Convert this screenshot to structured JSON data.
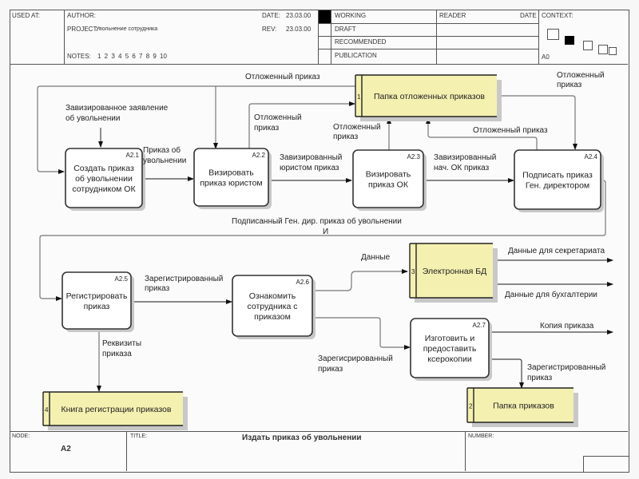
{
  "header": {
    "used_at_label": "USED AT:",
    "author_label": "AUTHOR:",
    "project_label": "PROJECT:",
    "project_value": "Увольнение сотрудника",
    "notes_label": "NOTES:",
    "notes_values": "1  2  3  4  5  6  7  8  9  10",
    "date_label": "DATE:",
    "date_value": "23.03.00",
    "rev_label": "REV:",
    "rev_value": "23.03.00",
    "status_options": [
      "WORKING",
      "DRAFT",
      "RECOMMENDED",
      "PUBLICATION"
    ],
    "status_selected": "WORKING",
    "reader_label": "READER",
    "reader_date_label": "DATE",
    "context_label": "CONTEXT:",
    "context_node": "A0"
  },
  "diagram": {
    "activities": [
      {
        "id": "A2.1",
        "lines": [
          "Создать приказ",
          "об увольнении",
          "сотрудником ОК"
        ]
      },
      {
        "id": "A2.2",
        "lines": [
          "Визировать",
          "приказ юристом"
        ]
      },
      {
        "id": "A2.3",
        "lines": [
          "Визировать",
          "приказ ОК"
        ]
      },
      {
        "id": "A2.4",
        "lines": [
          "Подписать приказ",
          "Ген. директором"
        ]
      },
      {
        "id": "A2.5",
        "lines": [
          "Регистрировать",
          "приказ"
        ]
      },
      {
        "id": "A2.6",
        "lines": [
          "Ознакомить",
          "сотрудника с",
          "приказом"
        ]
      },
      {
        "id": "A2.7",
        "lines": [
          "Изготовить и",
          "предоставить",
          "ксерокопии"
        ]
      }
    ],
    "data_stores": [
      {
        "num": "1",
        "label": "Папка отложенных приказов"
      },
      {
        "num": "2",
        "label": "Папка приказов"
      },
      {
        "num": "3",
        "label": "Электронная БД"
      },
      {
        "num": "4",
        "label": "Книга регистрации приказов"
      }
    ],
    "arrow_labels": {
      "postponed_top": "Отложенный приказ",
      "postponed_right": [
        "Отложенный",
        "приказ"
      ],
      "approved_application": [
        "Завизированное заявление",
        "об увольнении"
      ],
      "postponed_a22": [
        "Отложенный",
        "приказ"
      ],
      "postponed_a23": [
        "Отложенный",
        "приказ"
      ],
      "postponed_a24": "Отложенный приказ",
      "order_dismissal": [
        "Приказ об",
        "увольнении"
      ],
      "approved_by_lawyer": [
        "Завизированный",
        "юристом приказ"
      ],
      "approved_by_hr": [
        "Завизированный",
        "нач. ОК приказ"
      ],
      "signed_order": [
        "Подписанный Ген. дир. приказ об увольнении",
        "И"
      ],
      "registered_order_a25": [
        "Зарегистрированный",
        "приказ"
      ],
      "data": "Данные",
      "data_secretariat": "Данные для секретариата",
      "data_accounting": "Данные для бухгалтерии",
      "order_details": [
        "Реквизиты",
        "приказа"
      ],
      "registered_order_a26": [
        "Зарегисрированный",
        "приказ"
      ],
      "order_copy": "Копия приказа",
      "registered_order_a27": [
        "Зарегистрированный",
        "приказ"
      ]
    }
  },
  "footer": {
    "node_label": "NODE:",
    "node_value": "A2",
    "title_label": "TITLE:",
    "title_value": "Издать приказ об увольнении",
    "number_label": "NUMBER:"
  },
  "colors": {
    "store_fill": "#f4f0b0",
    "shadow": "#c8c8c8",
    "status_marker": "#000000"
  }
}
